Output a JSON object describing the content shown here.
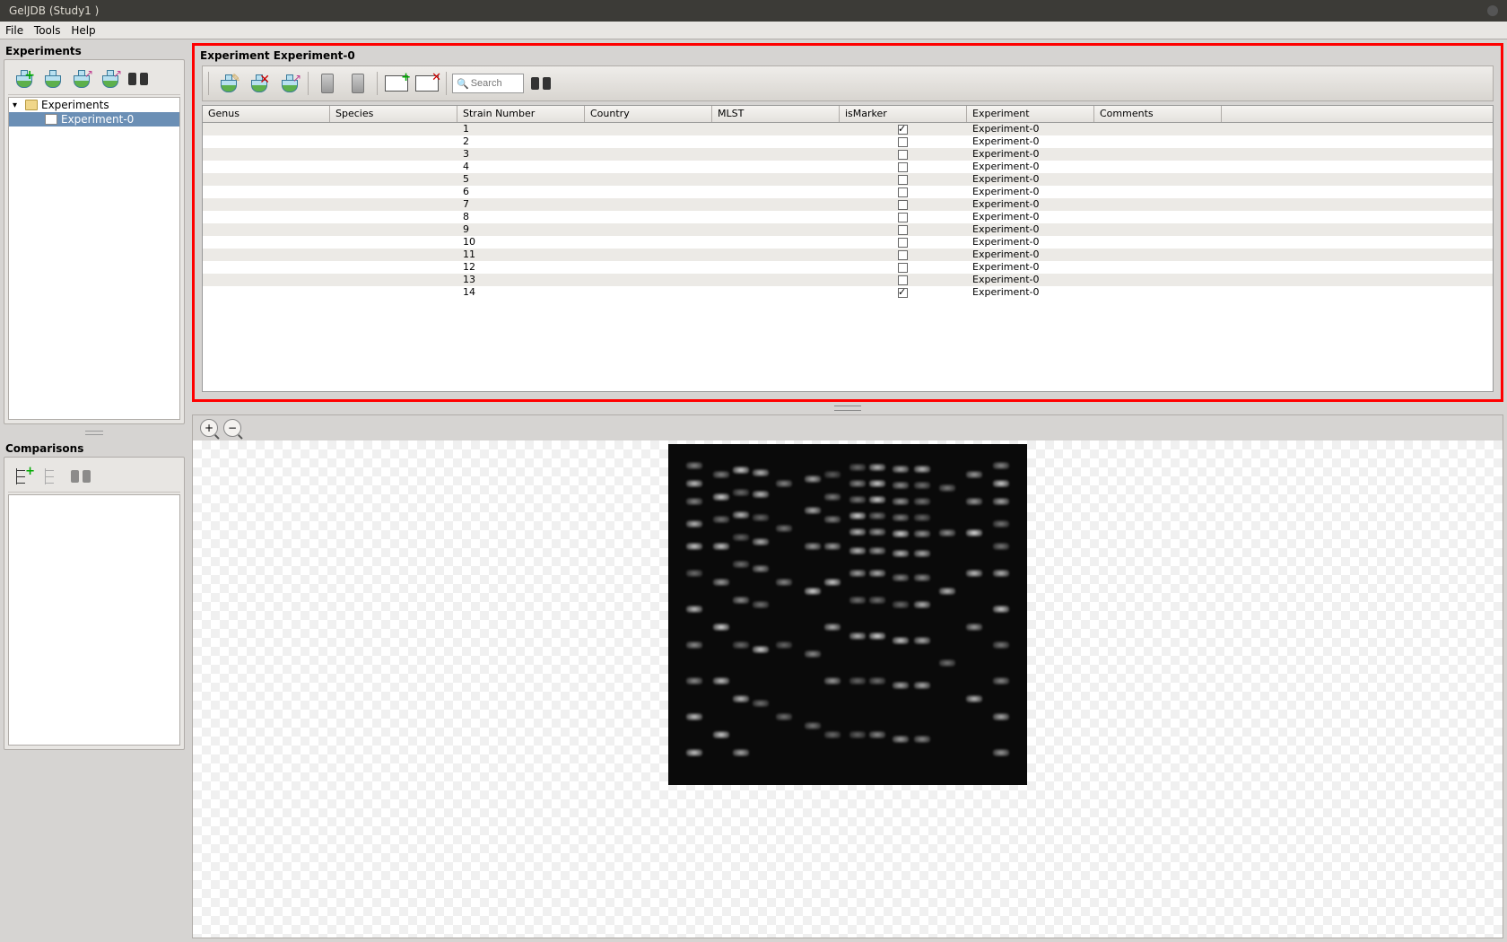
{
  "window": {
    "title": "GelJDB (Study1 )"
  },
  "menu": {
    "file": "File",
    "tools": "Tools",
    "help": "Help"
  },
  "experiments_panel": {
    "title": "Experiments",
    "tree": {
      "root": "Experiments",
      "child": "Experiment-0"
    }
  },
  "comparisons_panel": {
    "title": "Comparisons"
  },
  "experiment_view": {
    "title": "Experiment Experiment-0",
    "search_placeholder": "Search",
    "columns": {
      "genus": "Genus",
      "species": "Species",
      "strain": "Strain Number",
      "country": "Country",
      "mlst": "MLST",
      "isMarker": "isMarker",
      "experiment": "Experiment",
      "comments": "Comments"
    },
    "rows": [
      {
        "strain": "1",
        "isMarker": true,
        "experiment": "Experiment-0"
      },
      {
        "strain": "2",
        "isMarker": false,
        "experiment": "Experiment-0"
      },
      {
        "strain": "3",
        "isMarker": false,
        "experiment": "Experiment-0"
      },
      {
        "strain": "4",
        "isMarker": false,
        "experiment": "Experiment-0"
      },
      {
        "strain": "5",
        "isMarker": false,
        "experiment": "Experiment-0"
      },
      {
        "strain": "6",
        "isMarker": false,
        "experiment": "Experiment-0"
      },
      {
        "strain": "7",
        "isMarker": false,
        "experiment": "Experiment-0"
      },
      {
        "strain": "8",
        "isMarker": false,
        "experiment": "Experiment-0"
      },
      {
        "strain": "9",
        "isMarker": false,
        "experiment": "Experiment-0"
      },
      {
        "strain": "10",
        "isMarker": false,
        "experiment": "Experiment-0"
      },
      {
        "strain": "11",
        "isMarker": false,
        "experiment": "Experiment-0"
      },
      {
        "strain": "12",
        "isMarker": false,
        "experiment": "Experiment-0"
      },
      {
        "strain": "13",
        "isMarker": false,
        "experiment": "Experiment-0"
      },
      {
        "strain": "14",
        "isMarker": true,
        "experiment": "Experiment-0"
      }
    ]
  },
  "zoom": {
    "in": "+",
    "out": "−"
  }
}
